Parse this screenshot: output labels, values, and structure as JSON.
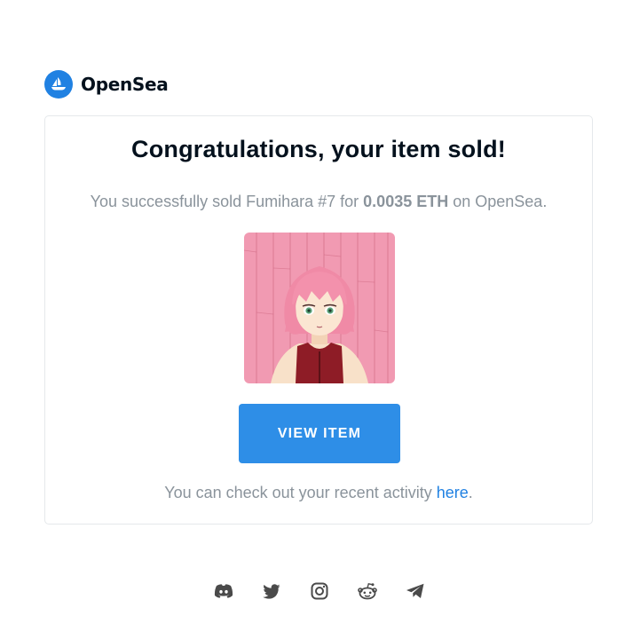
{
  "brand": {
    "name": "OpenSea",
    "logo_icon": "opensea-boat-icon",
    "color": "#2081e2"
  },
  "email": {
    "title": "Congratulations, your item sold!",
    "message": {
      "prefix": "You successfully sold Fumihara #7 for ",
      "amount": "0.0035 ETH",
      "suffix": " on OpenSea."
    },
    "nft_image": {
      "icon": "anime-girl-portrait",
      "background": "#f19ab2"
    },
    "cta_label": "VIEW ITEM",
    "cta_color": "#2e8ee7",
    "activity": {
      "prefix": "You can check out your recent activity ",
      "link": "here",
      "suffix": "."
    }
  },
  "socials": [
    {
      "icon": "discord-icon"
    },
    {
      "icon": "twitter-icon"
    },
    {
      "icon": "instagram-icon"
    },
    {
      "icon": "reddit-icon"
    },
    {
      "icon": "telegram-icon"
    }
  ]
}
